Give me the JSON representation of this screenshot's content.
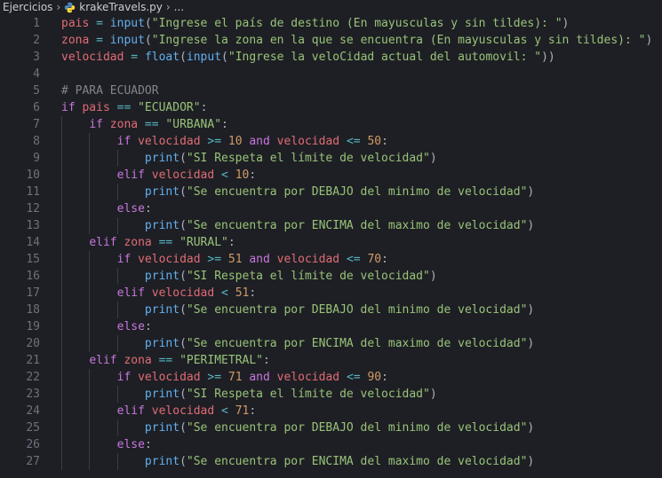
{
  "breadcrumb": {
    "folder": "Ejercicios",
    "file": "krakeTravels.py",
    "more": "..."
  },
  "colors": {
    "background": "#1e1f24",
    "variable": "#e06c75",
    "operator": "#56b6c2",
    "function": "#61afef",
    "string": "#98c379",
    "keyword": "#c678dd",
    "number": "#d19a66",
    "comment": "#7f848e"
  },
  "lines": [
    {
      "n": "1",
      "indent": 0,
      "tokens": [
        [
          "var",
          "pais"
        ],
        [
          "op",
          " = "
        ],
        [
          "fn",
          "input"
        ],
        [
          "p",
          "("
        ],
        [
          "str",
          "\"Ingrese el país de destino (En mayusculas y sin tildes): \""
        ],
        [
          "p",
          ")"
        ]
      ]
    },
    {
      "n": "2",
      "indent": 0,
      "tokens": [
        [
          "var",
          "zona"
        ],
        [
          "op",
          " = "
        ],
        [
          "fn",
          "input"
        ],
        [
          "p",
          "("
        ],
        [
          "str",
          "\"Ingrese la zona en la que se encuentra (En mayusculas y sin tildes): \""
        ],
        [
          "p",
          ")"
        ]
      ]
    },
    {
      "n": "3",
      "indent": 0,
      "tokens": [
        [
          "var",
          "velocidad"
        ],
        [
          "op",
          " = "
        ],
        [
          "fn",
          "float"
        ],
        [
          "p",
          "("
        ],
        [
          "fn",
          "input"
        ],
        [
          "p",
          "("
        ],
        [
          "str",
          "\"Ingrese la veloCidad actual del automovil: \""
        ],
        [
          "p",
          "))"
        ]
      ]
    },
    {
      "n": "4",
      "indent": 0,
      "tokens": []
    },
    {
      "n": "5",
      "indent": 0,
      "tokens": [
        [
          "cm",
          "# PARA ECUADOR"
        ]
      ]
    },
    {
      "n": "6",
      "indent": 0,
      "tokens": [
        [
          "kw",
          "if "
        ],
        [
          "var",
          "pais"
        ],
        [
          "op",
          " == "
        ],
        [
          "str",
          "\"ECUADOR\""
        ],
        [
          "p",
          ":"
        ]
      ]
    },
    {
      "n": "7",
      "indent": 1,
      "tokens": [
        [
          "kw",
          "if "
        ],
        [
          "var",
          "zona"
        ],
        [
          "op",
          " == "
        ],
        [
          "str",
          "\"URBANA\""
        ],
        [
          "p",
          ":"
        ]
      ]
    },
    {
      "n": "8",
      "indent": 2,
      "tokens": [
        [
          "kw",
          "if "
        ],
        [
          "var",
          "velocidad"
        ],
        [
          "op",
          " >= "
        ],
        [
          "num",
          "10"
        ],
        [
          "kw",
          " and "
        ],
        [
          "var",
          "velocidad"
        ],
        [
          "op",
          " <= "
        ],
        [
          "num",
          "50"
        ],
        [
          "p",
          ":"
        ]
      ]
    },
    {
      "n": "9",
      "indent": 3,
      "tokens": [
        [
          "fn",
          "print"
        ],
        [
          "p",
          "("
        ],
        [
          "str",
          "\"SI Respeta el límite de velocidad\""
        ],
        [
          "p",
          ")"
        ]
      ]
    },
    {
      "n": "10",
      "indent": 2,
      "tokens": [
        [
          "kw",
          "elif "
        ],
        [
          "var",
          "velocidad"
        ],
        [
          "op",
          " < "
        ],
        [
          "num",
          "10"
        ],
        [
          "p",
          ":"
        ]
      ]
    },
    {
      "n": "11",
      "indent": 3,
      "tokens": [
        [
          "fn",
          "print"
        ],
        [
          "p",
          "("
        ],
        [
          "str",
          "\"Se encuentra por DEBAJO del minimo de velocidad\""
        ],
        [
          "p",
          ")"
        ]
      ]
    },
    {
      "n": "12",
      "indent": 2,
      "tokens": [
        [
          "kw",
          "else"
        ],
        [
          "p",
          ":"
        ]
      ]
    },
    {
      "n": "13",
      "indent": 3,
      "tokens": [
        [
          "fn",
          "print"
        ],
        [
          "p",
          "("
        ],
        [
          "str",
          "\"Se encuentra por ENCIMA del maximo de velocidad\""
        ],
        [
          "p",
          ")"
        ]
      ]
    },
    {
      "n": "14",
      "indent": 1,
      "tokens": [
        [
          "kw",
          "elif "
        ],
        [
          "var",
          "zona"
        ],
        [
          "op",
          " == "
        ],
        [
          "str",
          "\"RURAL\""
        ],
        [
          "p",
          ":"
        ]
      ]
    },
    {
      "n": "15",
      "indent": 2,
      "tokens": [
        [
          "kw",
          "if "
        ],
        [
          "var",
          "velocidad"
        ],
        [
          "op",
          " >= "
        ],
        [
          "num",
          "51"
        ],
        [
          "kw",
          " and "
        ],
        [
          "var",
          "velocidad"
        ],
        [
          "op",
          " <= "
        ],
        [
          "num",
          "70"
        ],
        [
          "p",
          ":"
        ]
      ]
    },
    {
      "n": "16",
      "indent": 3,
      "tokens": [
        [
          "fn",
          "print"
        ],
        [
          "p",
          "("
        ],
        [
          "str",
          "\"SI Respeta el límite de velocidad\""
        ],
        [
          "p",
          ")"
        ]
      ]
    },
    {
      "n": "17",
      "indent": 2,
      "tokens": [
        [
          "kw",
          "elif "
        ],
        [
          "var",
          "velocidad"
        ],
        [
          "op",
          " < "
        ],
        [
          "num",
          "51"
        ],
        [
          "p",
          ":"
        ]
      ]
    },
    {
      "n": "18",
      "indent": 3,
      "tokens": [
        [
          "fn",
          "print"
        ],
        [
          "p",
          "("
        ],
        [
          "str",
          "\"Se encuentra por DEBAJO del minimo de velocidad\""
        ],
        [
          "p",
          ")"
        ]
      ]
    },
    {
      "n": "19",
      "indent": 2,
      "tokens": [
        [
          "kw",
          "else"
        ],
        [
          "p",
          ":"
        ]
      ]
    },
    {
      "n": "20",
      "indent": 3,
      "tokens": [
        [
          "fn",
          "print"
        ],
        [
          "p",
          "("
        ],
        [
          "str",
          "\"Se encuentra por ENCIMA del maximo de velocidad\""
        ],
        [
          "p",
          ")"
        ]
      ]
    },
    {
      "n": "21",
      "indent": 1,
      "tokens": [
        [
          "kw",
          "elif "
        ],
        [
          "var",
          "zona"
        ],
        [
          "op",
          " == "
        ],
        [
          "str",
          "\"PERIMETRAL\""
        ],
        [
          "p",
          ":"
        ]
      ]
    },
    {
      "n": "22",
      "indent": 2,
      "tokens": [
        [
          "kw",
          "if "
        ],
        [
          "var",
          "velocidad"
        ],
        [
          "op",
          " >= "
        ],
        [
          "num",
          "71"
        ],
        [
          "kw",
          " and "
        ],
        [
          "var",
          "velocidad"
        ],
        [
          "op",
          " <= "
        ],
        [
          "num",
          "90"
        ],
        [
          "p",
          ":"
        ]
      ]
    },
    {
      "n": "23",
      "indent": 3,
      "tokens": [
        [
          "fn",
          "print"
        ],
        [
          "p",
          "("
        ],
        [
          "str",
          "\"SI Respeta el límite de velocidad\""
        ],
        [
          "p",
          ")"
        ]
      ]
    },
    {
      "n": "24",
      "indent": 2,
      "tokens": [
        [
          "kw",
          "elif "
        ],
        [
          "var",
          "velocidad"
        ],
        [
          "op",
          " < "
        ],
        [
          "num",
          "71"
        ],
        [
          "p",
          ":"
        ]
      ]
    },
    {
      "n": "25",
      "indent": 3,
      "tokens": [
        [
          "fn",
          "print"
        ],
        [
          "p",
          "("
        ],
        [
          "str",
          "\"Se encuentra por DEBAJO del minimo de velocidad\""
        ],
        [
          "p",
          ")"
        ]
      ]
    },
    {
      "n": "26",
      "indent": 2,
      "tokens": [
        [
          "kw",
          "else"
        ],
        [
          "p",
          ":"
        ]
      ]
    },
    {
      "n": "27",
      "indent": 3,
      "tokens": [
        [
          "fn",
          "print"
        ],
        [
          "p",
          "("
        ],
        [
          "str",
          "\"Se encuentra por ENCIMA del maximo de velocidad\""
        ],
        [
          "p",
          ")"
        ]
      ]
    }
  ]
}
